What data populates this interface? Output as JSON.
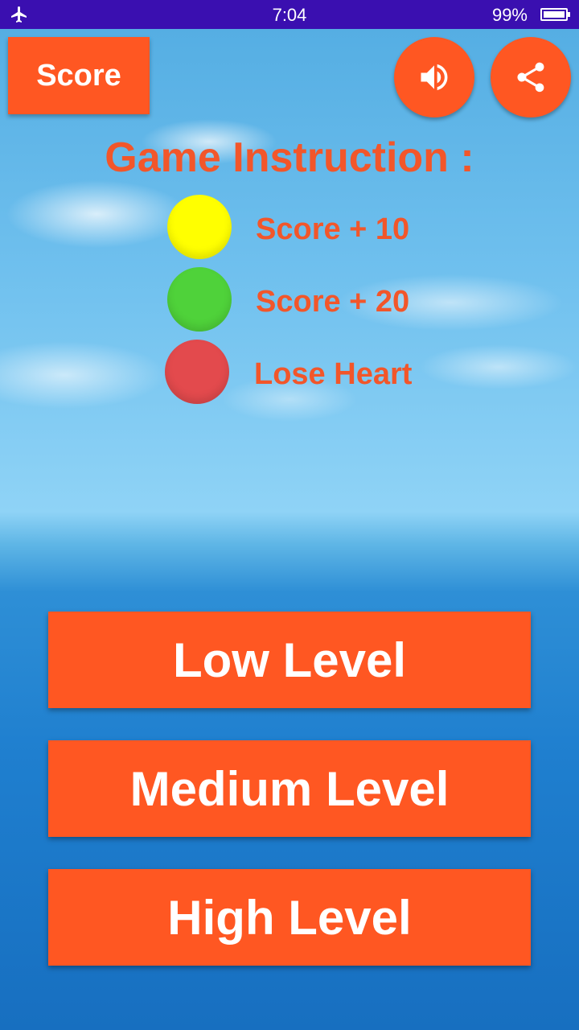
{
  "status_bar": {
    "time": "7:04",
    "battery": "99%"
  },
  "header": {
    "score_label": "Score"
  },
  "instructions": {
    "title": "Game Instruction :",
    "items": [
      {
        "color": "#ffff00",
        "label": "Score + 10"
      },
      {
        "color": "#4fd23a",
        "label": "Score + 20"
      },
      {
        "color": "#e34a4d",
        "label": "Lose Heart"
      }
    ]
  },
  "levels": {
    "low": "Low Level",
    "medium": "Medium Level",
    "high": "High Level"
  },
  "colors": {
    "accent": "#ff5722",
    "title_text": "#f2562a",
    "status_bar": "#3a0fb0"
  },
  "icons": {
    "status": "airplane-icon",
    "sound": "speaker-icon",
    "share": "share-icon"
  }
}
